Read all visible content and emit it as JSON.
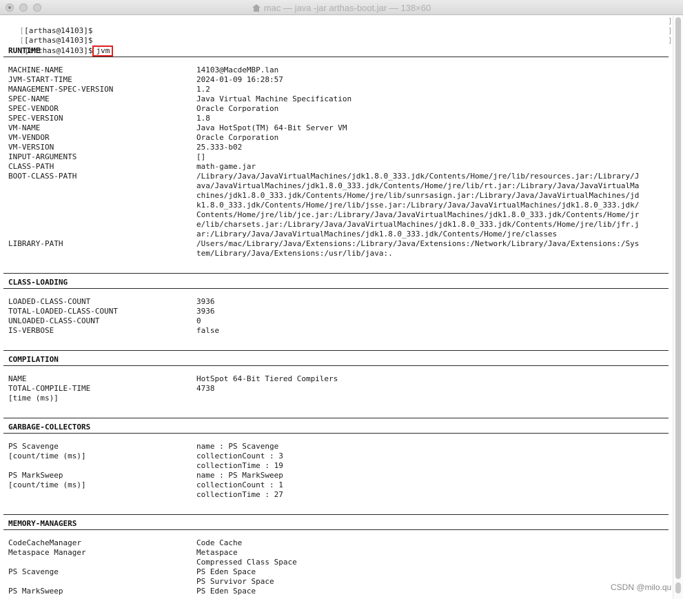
{
  "window": {
    "title": "mac — java -jar arthas-boot.jar — 138×60"
  },
  "prompt": "[arthas@14103]$",
  "command": "jvm",
  "sections": [
    {
      "title": "RUNTIME",
      "rows": [
        {
          "k": "MACHINE-NAME",
          "v": [
            "14103@MacdeMBP.lan"
          ]
        },
        {
          "k": "JVM-START-TIME",
          "v": [
            "2024-01-09 16:28:57"
          ]
        },
        {
          "k": "MANAGEMENT-SPEC-VERSION",
          "v": [
            "1.2"
          ]
        },
        {
          "k": "SPEC-NAME",
          "v": [
            "Java Virtual Machine Specification"
          ]
        },
        {
          "k": "SPEC-VENDOR",
          "v": [
            "Oracle Corporation"
          ]
        },
        {
          "k": "SPEC-VERSION",
          "v": [
            "1.8"
          ]
        },
        {
          "k": "VM-NAME",
          "v": [
            "Java HotSpot(TM) 64-Bit Server VM"
          ]
        },
        {
          "k": "VM-VENDOR",
          "v": [
            "Oracle Corporation"
          ]
        },
        {
          "k": "VM-VERSION",
          "v": [
            "25.333-b02"
          ]
        },
        {
          "k": "INPUT-ARGUMENTS",
          "v": [
            "[]"
          ]
        },
        {
          "k": "CLASS-PATH",
          "v": [
            "math-game.jar"
          ]
        },
        {
          "k": "BOOT-CLASS-PATH",
          "v": [
            "/Library/Java/JavaVirtualMachines/jdk1.8.0_333.jdk/Contents/Home/jre/lib/resources.jar:/Library/J",
            "ava/JavaVirtualMachines/jdk1.8.0_333.jdk/Contents/Home/jre/lib/rt.jar:/Library/Java/JavaVirtualMa",
            "chines/jdk1.8.0_333.jdk/Contents/Home/jre/lib/sunrsasign.jar:/Library/Java/JavaVirtualMachines/jd",
            "k1.8.0_333.jdk/Contents/Home/jre/lib/jsse.jar:/Library/Java/JavaVirtualMachines/jdk1.8.0_333.jdk/",
            "Contents/Home/jre/lib/jce.jar:/Library/Java/JavaVirtualMachines/jdk1.8.0_333.jdk/Contents/Home/jr",
            "e/lib/charsets.jar:/Library/Java/JavaVirtualMachines/jdk1.8.0_333.jdk/Contents/Home/jre/lib/jfr.j",
            "ar:/Library/Java/JavaVirtualMachines/jdk1.8.0_333.jdk/Contents/Home/jre/classes"
          ]
        },
        {
          "k": "LIBRARY-PATH",
          "v": [
            "/Users/mac/Library/Java/Extensions:/Library/Java/Extensions:/Network/Library/Java/Extensions:/Sys",
            "tem/Library/Java/Extensions:/usr/lib/java:."
          ]
        }
      ]
    },
    {
      "title": "CLASS-LOADING",
      "rows": [
        {
          "k": "LOADED-CLASS-COUNT",
          "v": [
            "3936"
          ]
        },
        {
          "k": "TOTAL-LOADED-CLASS-COUNT",
          "v": [
            "3936"
          ]
        },
        {
          "k": "UNLOADED-CLASS-COUNT",
          "v": [
            "0"
          ]
        },
        {
          "k": "IS-VERBOSE",
          "v": [
            "false"
          ]
        }
      ]
    },
    {
      "title": "COMPILATION",
      "rows": [
        {
          "k": "NAME",
          "v": [
            "HotSpot 64-Bit Tiered Compilers"
          ]
        },
        {
          "k": "TOTAL-COMPILE-TIME",
          "v": [
            "4738"
          ]
        },
        {
          "k": "[time (ms)]",
          "v": []
        }
      ]
    },
    {
      "title": "GARBAGE-COLLECTORS",
      "rows": [
        {
          "k": "PS Scavenge",
          "v": [
            "name : PS Scavenge"
          ]
        },
        {
          "k": "[count/time (ms)]",
          "v": [
            "collectionCount : 3"
          ]
        },
        {
          "k": "",
          "v": [
            "collectionTime : 19"
          ]
        },
        {
          "k": "PS MarkSweep",
          "v": [
            "name : PS MarkSweep"
          ]
        },
        {
          "k": "[count/time (ms)]",
          "v": [
            "collectionCount : 1"
          ]
        },
        {
          "k": "",
          "v": [
            "collectionTime : 27"
          ]
        }
      ]
    },
    {
      "title": "MEMORY-MANAGERS",
      "rows": [
        {
          "k": "CodeCacheManager",
          "v": [
            "Code Cache"
          ]
        },
        {
          "k": "Metaspace Manager",
          "v": [
            "Metaspace"
          ]
        },
        {
          "k": "",
          "v": [
            "Compressed Class Space"
          ]
        },
        {
          "k": "PS Scavenge",
          "v": [
            "PS Eden Space"
          ]
        },
        {
          "k": "",
          "v": [
            "PS Survivor Space"
          ]
        },
        {
          "k": "PS MarkSweep",
          "v": [
            "PS Eden Space"
          ]
        }
      ]
    }
  ],
  "watermark": "CSDN @milo.qu"
}
